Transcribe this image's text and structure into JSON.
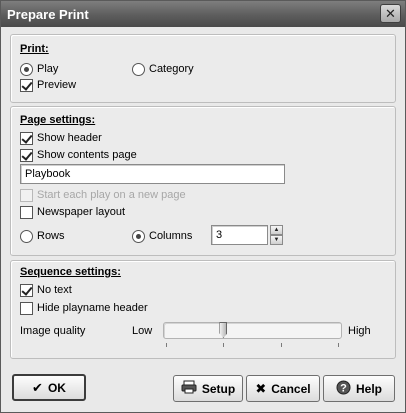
{
  "window": {
    "title": "Prepare Print",
    "close_glyph": "✕"
  },
  "print_group": {
    "title": "Print:",
    "play_label": "Play",
    "play_selected": true,
    "category_label": "Category",
    "category_selected": false,
    "preview_label": "Preview",
    "preview_checked": true
  },
  "page_group": {
    "title": "Page settings:",
    "show_header_label": "Show header",
    "show_header_checked": true,
    "show_contents_label": "Show contents page",
    "show_contents_checked": true,
    "contents_title_value": "Playbook",
    "new_page_label": "Start each play on a new page",
    "new_page_checked": false,
    "new_page_enabled": false,
    "newspaper_label": "Newspaper layout",
    "newspaper_checked": false,
    "rows_label": "Rows",
    "rows_selected": false,
    "columns_label": "Columns",
    "columns_selected": true,
    "columns_value": "3"
  },
  "sequence_group": {
    "title": "Sequence settings:",
    "no_text_label": "No text",
    "no_text_checked": true,
    "hide_header_label": "Hide playname header",
    "hide_header_checked": false,
    "quality_label": "Image quality",
    "low_label": "Low",
    "high_label": "High",
    "quality_level_fraction": 0.33
  },
  "buttons": {
    "ok_label": "OK",
    "ok_icon": "checkmark-icon",
    "setup_label": "Setup",
    "setup_icon": "printer-icon",
    "cancel_label": "Cancel",
    "cancel_icon": "x-icon",
    "help_label": "Help",
    "help_icon": "help-icon"
  }
}
